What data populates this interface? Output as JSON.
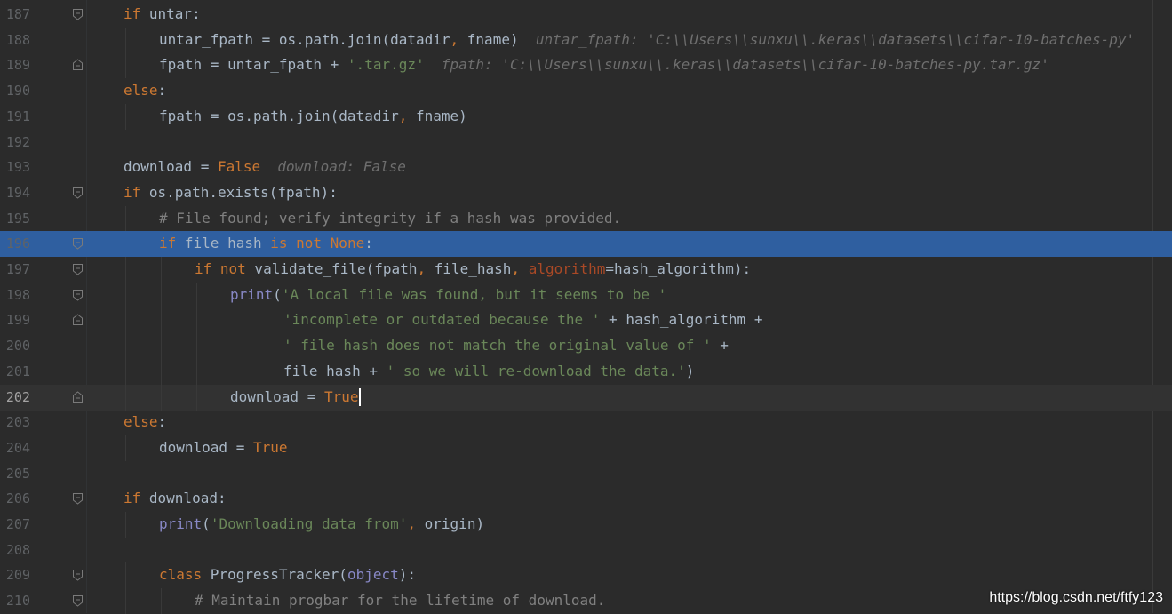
{
  "editor": {
    "lines": [
      {
        "num": "187",
        "indent": 1,
        "fold": "open",
        "tokens": [
          {
            "t": "kw",
            "v": "if"
          },
          {
            "t": "plain",
            "v": " untar:"
          }
        ]
      },
      {
        "num": "188",
        "indent": 2,
        "tokens": [
          {
            "t": "plain",
            "v": "untar_fpath = os.path.join(datadir"
          },
          {
            "t": "kw",
            "v": ","
          },
          {
            "t": "plain",
            "v": " fname)  "
          },
          {
            "t": "hint",
            "v": "untar_fpath: 'C:\\\\Users\\\\sunxu\\\\.keras\\\\datasets\\\\cifar-10-batches-py'"
          }
        ]
      },
      {
        "num": "189",
        "indent": 2,
        "fold": "close",
        "tokens": [
          {
            "t": "plain",
            "v": "fpath = untar_fpath + "
          },
          {
            "t": "str",
            "v": "'.tar.gz'"
          },
          {
            "t": "plain",
            "v": "  "
          },
          {
            "t": "hint",
            "v": "fpath: 'C:\\\\Users\\\\sunxu\\\\.keras\\\\datasets\\\\cifar-10-batches-py.tar.gz'"
          }
        ]
      },
      {
        "num": "190",
        "indent": 1,
        "tokens": [
          {
            "t": "kw",
            "v": "else"
          },
          {
            "t": "plain",
            "v": ":"
          }
        ]
      },
      {
        "num": "191",
        "indent": 2,
        "tokens": [
          {
            "t": "plain",
            "v": "fpath = os.path.join(datadir"
          },
          {
            "t": "kw",
            "v": ","
          },
          {
            "t": "plain",
            "v": " fname)"
          }
        ]
      },
      {
        "num": "192",
        "indent": 0,
        "tokens": []
      },
      {
        "num": "193",
        "indent": 1,
        "tokens": [
          {
            "t": "plain",
            "v": "download = "
          },
          {
            "t": "kw",
            "v": "False"
          },
          {
            "t": "plain",
            "v": "  "
          },
          {
            "t": "hint",
            "v": "download: False"
          }
        ]
      },
      {
        "num": "194",
        "indent": 1,
        "fold": "open",
        "tokens": [
          {
            "t": "kw",
            "v": "if"
          },
          {
            "t": "plain",
            "v": " os.path.exists(fpath):"
          }
        ]
      },
      {
        "num": "195",
        "indent": 2,
        "tokens": [
          {
            "t": "cmt",
            "v": "# File found; verify integrity if a hash was provided."
          }
        ]
      },
      {
        "num": "196",
        "indent": 2,
        "fold": "open",
        "selected": true,
        "tokens": [
          {
            "t": "kw",
            "v": "if"
          },
          {
            "t": "plain",
            "v": " file_hash "
          },
          {
            "t": "kw",
            "v": "is not"
          },
          {
            "t": "plain",
            "v": " "
          },
          {
            "t": "kw",
            "v": "None"
          },
          {
            "t": "plain",
            "v": ":"
          }
        ]
      },
      {
        "num": "197",
        "indent": 3,
        "fold": "open",
        "tokens": [
          {
            "t": "kw",
            "v": "if not"
          },
          {
            "t": "plain",
            "v": " validate_file(fpath"
          },
          {
            "t": "kw",
            "v": ","
          },
          {
            "t": "plain",
            "v": " file_hash"
          },
          {
            "t": "kw",
            "v": ","
          },
          {
            "t": "plain",
            "v": " "
          },
          {
            "t": "param",
            "v": "algorithm"
          },
          {
            "t": "plain",
            "v": "=hash_algorithm):"
          }
        ]
      },
      {
        "num": "198",
        "indent": 4,
        "fold": "open",
        "tokens": [
          {
            "t": "builtin",
            "v": "print"
          },
          {
            "t": "plain",
            "v": "("
          },
          {
            "t": "str",
            "v": "'A local file was found, but it seems to be '"
          }
        ]
      },
      {
        "num": "199",
        "indent": 4,
        "fold": "close",
        "extra": 60,
        "tokens": [
          {
            "t": "str",
            "v": "'incomplete or outdated because the '"
          },
          {
            "t": "plain",
            "v": " + hash_algorithm +"
          }
        ]
      },
      {
        "num": "200",
        "indent": 4,
        "extra": 60,
        "tokens": [
          {
            "t": "str",
            "v": "' file hash does not match the original value of '"
          },
          {
            "t": "plain",
            "v": " +"
          }
        ]
      },
      {
        "num": "201",
        "indent": 4,
        "extra": 60,
        "tokens": [
          {
            "t": "plain",
            "v": "file_hash + "
          },
          {
            "t": "str",
            "v": "' so we will re-download the data.'"
          },
          {
            "t": "plain",
            "v": ")"
          }
        ]
      },
      {
        "num": "202",
        "indent": 4,
        "fold": "close",
        "current": true,
        "tokens": [
          {
            "t": "plain",
            "v": "download = "
          },
          {
            "t": "kw",
            "v": "True"
          }
        ]
      },
      {
        "num": "203",
        "indent": 1,
        "tokens": [
          {
            "t": "kw",
            "v": "else"
          },
          {
            "t": "plain",
            "v": ":"
          }
        ]
      },
      {
        "num": "204",
        "indent": 2,
        "tokens": [
          {
            "t": "plain",
            "v": "download = "
          },
          {
            "t": "kw",
            "v": "True"
          }
        ]
      },
      {
        "num": "205",
        "indent": 0,
        "tokens": []
      },
      {
        "num": "206",
        "indent": 1,
        "fold": "open",
        "tokens": [
          {
            "t": "kw",
            "v": "if"
          },
          {
            "t": "plain",
            "v": " download:"
          }
        ]
      },
      {
        "num": "207",
        "indent": 2,
        "tokens": [
          {
            "t": "builtin",
            "v": "print"
          },
          {
            "t": "plain",
            "v": "("
          },
          {
            "t": "str",
            "v": "'Downloading data from'"
          },
          {
            "t": "kw",
            "v": ","
          },
          {
            "t": "plain",
            "v": " origin)"
          }
        ]
      },
      {
        "num": "208",
        "indent": 0,
        "tokens": []
      },
      {
        "num": "209",
        "indent": 2,
        "fold": "open",
        "tokens": [
          {
            "t": "kw",
            "v": "class"
          },
          {
            "t": "plain",
            "v": " ProgressTracker("
          },
          {
            "t": "builtin",
            "v": "object"
          },
          {
            "t": "plain",
            "v": "):"
          }
        ]
      },
      {
        "num": "210",
        "indent": 3,
        "fold": "open",
        "tokens": [
          {
            "t": "cmt",
            "v": "# Maintain progbar for the lifetime of download."
          }
        ]
      }
    ]
  },
  "watermark": "https://blog.csdn.net/ftfy123",
  "colors": {
    "background": "#2b2b2b",
    "keyword": "#cc7832",
    "string": "#6a8759",
    "comment": "#808080",
    "selection": "#2f5fa0"
  }
}
